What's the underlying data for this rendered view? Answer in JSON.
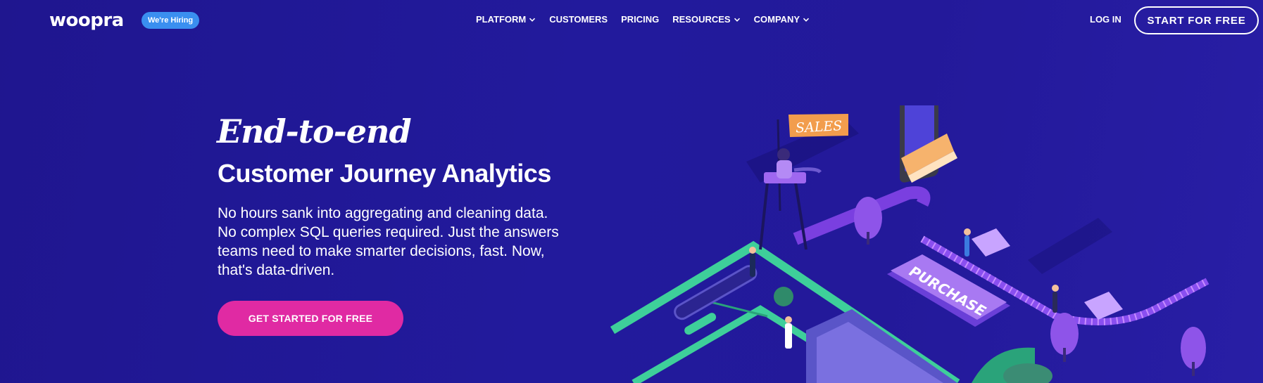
{
  "header": {
    "logo": "woopra",
    "hiring_badge": "We're Hiring",
    "nav": [
      {
        "label": "PLATFORM",
        "has_dropdown": true
      },
      {
        "label": "CUSTOMERS",
        "has_dropdown": false
      },
      {
        "label": "PRICING",
        "has_dropdown": false
      },
      {
        "label": "RESOURCES",
        "has_dropdown": true
      },
      {
        "label": "COMPANY",
        "has_dropdown": true
      }
    ],
    "login": "LOG IN",
    "start_button": "START FOR FREE"
  },
  "hero": {
    "script_title": "End-to-end",
    "title": "Customer Journey Analytics",
    "description": "No hours sank into aggregating and cleaning data. No complex SQL queries required. Just the answers teams need to make smarter decisions, fast. Now, that's data-driven.",
    "cta": "GET STARTED FOR FREE"
  },
  "illustration": {
    "flag_label": "SALES",
    "purchase_label": "PURCHASE"
  },
  "colors": {
    "background": "#221a9c",
    "cta": "#e02aa3",
    "hiring_badge": "#3a8ff0",
    "accent_green": "#3ecf9a",
    "accent_purple": "#7a3fe0"
  }
}
